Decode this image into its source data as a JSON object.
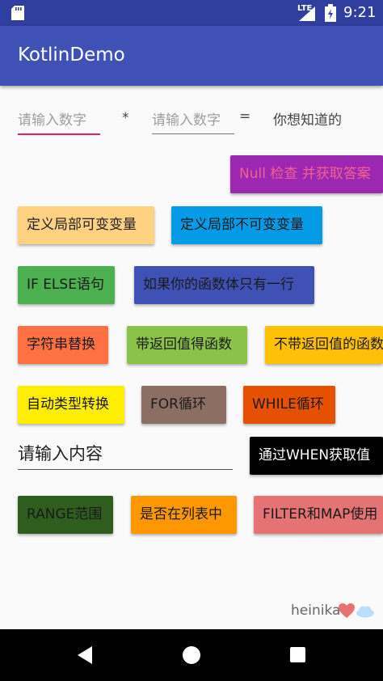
{
  "statusbar": {
    "network": "LTE",
    "time": "9:21"
  },
  "appbar": {
    "title": "KotlinDemo"
  },
  "calc": {
    "input1_placeholder": "请输入数字",
    "operator": "*",
    "input2_placeholder": "请输入数字",
    "equals": "=",
    "result": "你想知道的"
  },
  "buttons": {
    "null_check": "Null 检查 并获取答案",
    "local_var": "定义局部可变变量",
    "local_val": "定义局部不可变变量",
    "if_else": "IF ELSE语句",
    "single_line_fn": "如果你的函数体只有一行",
    "string_replace": "字符串替换",
    "fn_with_return": "带返回值得函数",
    "fn_without_return": "不带返回值的函数",
    "auto_cast": "自动类型转换",
    "for_loop": "FOR循环",
    "while_loop": "WHILE循环",
    "when_value": "通过WHEN获取值",
    "range": "RANGE范围",
    "in_list": "是否在列表中",
    "filter_map": "FILTER和MAP使用"
  },
  "content_input": {
    "placeholder": "请输入内容"
  },
  "footer": {
    "author": "heinika"
  },
  "colors": {
    "status_bar": "#303f9f",
    "app_bar": "#3f51b5",
    "accent": "#e91e63"
  }
}
